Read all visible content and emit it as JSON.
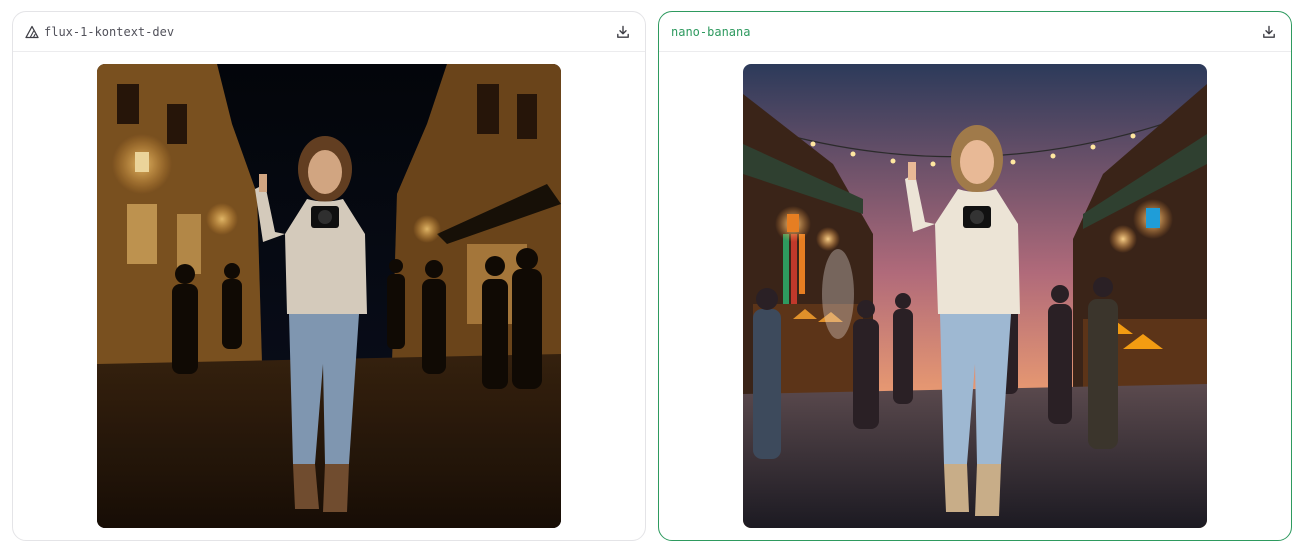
{
  "panels": [
    {
      "model_name": "flux-1-kontext-dev",
      "model_icon": "triangle-logo-icon",
      "download_icon": "download-icon",
      "image_alt": "Woman in a cream sweater making a peace sign on a night street",
      "selected": false
    },
    {
      "model_name": "nano-banana",
      "model_icon": "",
      "download_icon": "download-icon",
      "image_alt": "Woman in a cream sweater making a peace sign in a lantern-lit night market",
      "selected": true,
      "accent_color": "#2e9a5f"
    }
  ]
}
